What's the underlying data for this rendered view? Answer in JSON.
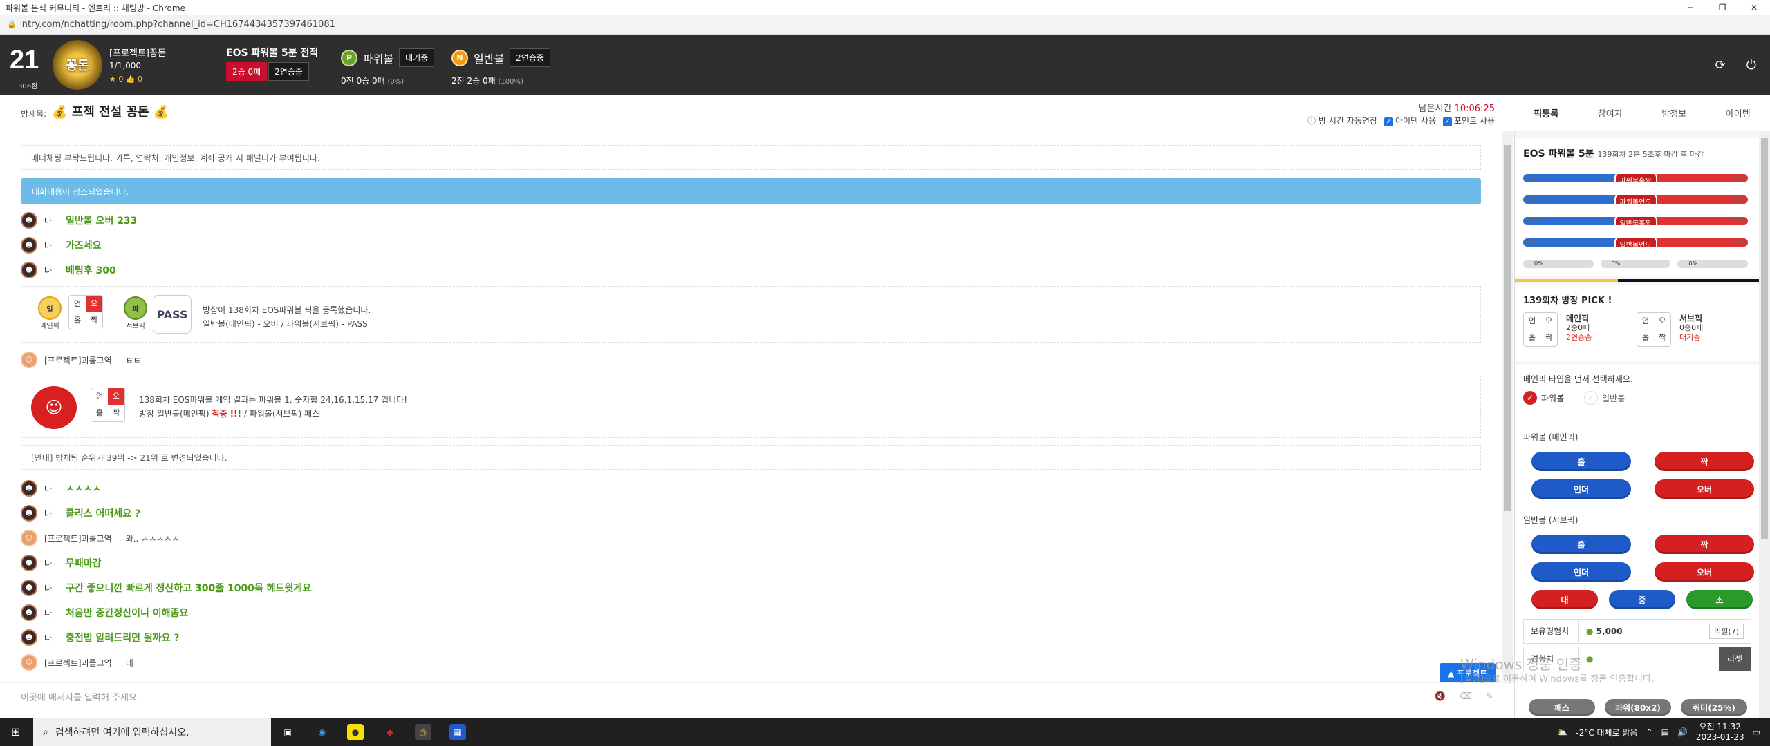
{
  "browser": {
    "title": "파워볼 분석 커뮤니티 - 엔트리 :: 채팅방 - Chrome",
    "url": "ntry.com/nchatting/room.php?channel_id=CH1674434357397461081"
  },
  "header": {
    "level": "21",
    "points": "306점",
    "logo_text": "꽁돈",
    "username": "[프로젝트]꽁돈",
    "member_count": "1/1,000",
    "stars": "★ 0  👍 0",
    "record_title": "EOS 파워볼 5분 전적",
    "record_badge1": "2승 0패",
    "record_badge2": "2연승중",
    "powerball_label": "파워볼",
    "powerball_status": "대기중",
    "powerball_stat": "0전 0승 0패",
    "powerball_pct": "(0%)",
    "normal_label": "일반볼",
    "normal_status": "2연승중",
    "normal_stat": "2전 2승 0패",
    "normal_pct": "(100%)"
  },
  "room": {
    "label": "방제목:",
    "title": "프젝 전설 꽁돈",
    "remain_label": "남은시간",
    "remain_time": "10:06:25",
    "opt1": "방 시간 자동연장",
    "opt2": "아이템 사용",
    "opt3": "포인트 사용"
  },
  "tabs": [
    "픽등록",
    "참여자",
    "방정보",
    "아이템"
  ],
  "chat": {
    "notice": "매너채팅 부탁드립니다. 카톡, 연락처, 개인정보, 계좌 공개 시 패널티가 부여됩니다.",
    "cleared": "대화내용이 청소되었습니다.",
    "me": "나",
    "other_user": "[프로젝트]괴롤고역",
    "messages": [
      "일반볼 오버 233",
      "가즈세요",
      "베팅후 300"
    ],
    "pick_notice": {
      "main_label": "메인픽",
      "sub_label": "서브픽",
      "pass": "PASS",
      "line1": "방장이 138회차 EOS파워볼 픽을 등록했습니다.",
      "line2": "일반볼(메인픽) - 오버 / 파워볼(서브픽) - PASS"
    },
    "other_msg1": "ㅌㅌ",
    "result": {
      "line1": "138회차 EOS파워볼 게임 결과는 파워볼 1, 숫자합 24,16,1,15,17 입니다!",
      "line2a": "방장 일반볼(메인픽)",
      "line2b": "적중 !!!",
      "line2c": "/ 파워볼(서브픽) 패스"
    },
    "rank_notice": "[안내] 방채팅 순위가 39위 -> 21위 로 변경되었습니다.",
    "messages2": [
      "ㅅㅅㅅㅅ",
      "클리스 어떠세요 ?"
    ],
    "other_msg2": "와.. ㅅㅅㅅㅅㅅ",
    "messages3": [
      "무패마감",
      "구간 좋으니깐 빠르게 정산하고 300줄 1000목 헤드윗게요",
      "처음만 중간정산이니 이해좀요",
      "충전법 알려드리면 될까요 ?"
    ],
    "other_msg3": "네",
    "input_placeholder": "이곳에 메세지를 입력해 주세요.",
    "float_btn": "▲ 프로젝트"
  },
  "grid": {
    "a": "언",
    "b": "오",
    "c": "홀",
    "d": "짝"
  },
  "side": {
    "game_title": "EOS 파워볼 5분",
    "game_sub": "139회차 2분 5초후 마감 후 마감",
    "bars": [
      {
        "label": "파워볼홀짝",
        "left": "57%",
        "right": "42%",
        "l": 57
      },
      {
        "label": "파워볼언오",
        "left": "43%",
        "right": "56%",
        "l": 43
      },
      {
        "label": "일반볼홀짝",
        "left": "41%",
        "right": "58%",
        "l": 41
      },
      {
        "label": "일반볼언오",
        "left": "45%",
        "right": "54%",
        "l": 45
      }
    ],
    "mini": [
      "0%",
      "0%",
      "0%"
    ],
    "pick_title": "139회차 방장 PICK !",
    "main_pick": "메인픽",
    "main_record": "2승0패",
    "main_streak": "2연승중",
    "sub_pick": "서브픽",
    "sub_record": "0승0패",
    "sub_status": "대기중",
    "select_hint": "메인픽 타입을 먼저 선택하세요.",
    "opt_powerball": "파워볼",
    "opt_normal": "일반볼",
    "sec1": "파워볼 (메인픽)",
    "sec2": "일반볼 (서브픽)",
    "btn_odd": "홀",
    "btn_even": "짝",
    "btn_under": "언더",
    "btn_over": "오버",
    "btn_big": "대",
    "btn_mid": "중",
    "btn_small": "소",
    "exp_label": "보유경험치",
    "exp_value": "5,000",
    "exp_btn": "리필(7)",
    "exp2_label": "경험치",
    "exp2_btn": "리셋",
    "bottom_btns": [
      "패스",
      "파워(80x2)",
      "쿼터(25%)"
    ]
  },
  "watermark": {
    "line1": "Windows 정품 인증",
    "line2": "[설정]으로 이동하여 Windows를 정품 인증합니다."
  },
  "taskbar": {
    "search": "검색하려면 여기에 입력하십시오.",
    "weather": "-2°C 대체로 맑음",
    "time": "오전 11:32",
    "date": "2023-01-23"
  }
}
